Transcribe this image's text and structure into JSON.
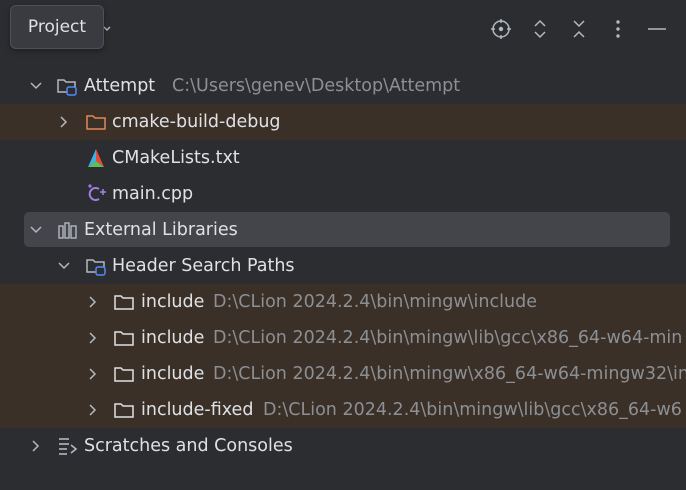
{
  "header": {
    "title": "Project"
  },
  "toolbar": {
    "icons": [
      "locate-icon",
      "expand-all-icon",
      "collapse-all-icon",
      "more-options-icon",
      "hide-icon"
    ]
  },
  "tree": {
    "attempt": {
      "label": "Attempt",
      "path": "C:\\Users\\genev\\Desktop\\Attempt"
    },
    "cmake_build_debug": {
      "label": "cmake-build-debug"
    },
    "cmakelists": {
      "label": "CMakeLists.txt"
    },
    "main_cpp": {
      "label": "main.cpp"
    },
    "external_libraries": {
      "label": "External Libraries"
    },
    "header_search_paths": {
      "label": "Header Search Paths"
    },
    "includes": [
      {
        "label": "include",
        "path": "D:\\CLion 2024.2.4\\bin\\mingw\\include"
      },
      {
        "label": "include",
        "path": "D:\\CLion 2024.2.4\\bin\\mingw\\lib\\gcc\\x86_64-w64-min"
      },
      {
        "label": "include",
        "path": "D:\\CLion 2024.2.4\\bin\\mingw\\x86_64-w64-mingw32\\in"
      },
      {
        "label": "include-fixed",
        "path": "D:\\CLion 2024.2.4\\bin\\mingw\\lib\\gcc\\x86_64-w6"
      }
    ],
    "scratches": {
      "label": "Scratches and Consoles"
    }
  },
  "colors": {
    "background": "#2b2d30",
    "scope_highlight": "#3a3028",
    "selection": "#43454a",
    "text": "#dfe1e5",
    "path_text": "#8c8f94",
    "folder_orange": "#e08855",
    "cpp_purple": "#9e7fe0"
  }
}
